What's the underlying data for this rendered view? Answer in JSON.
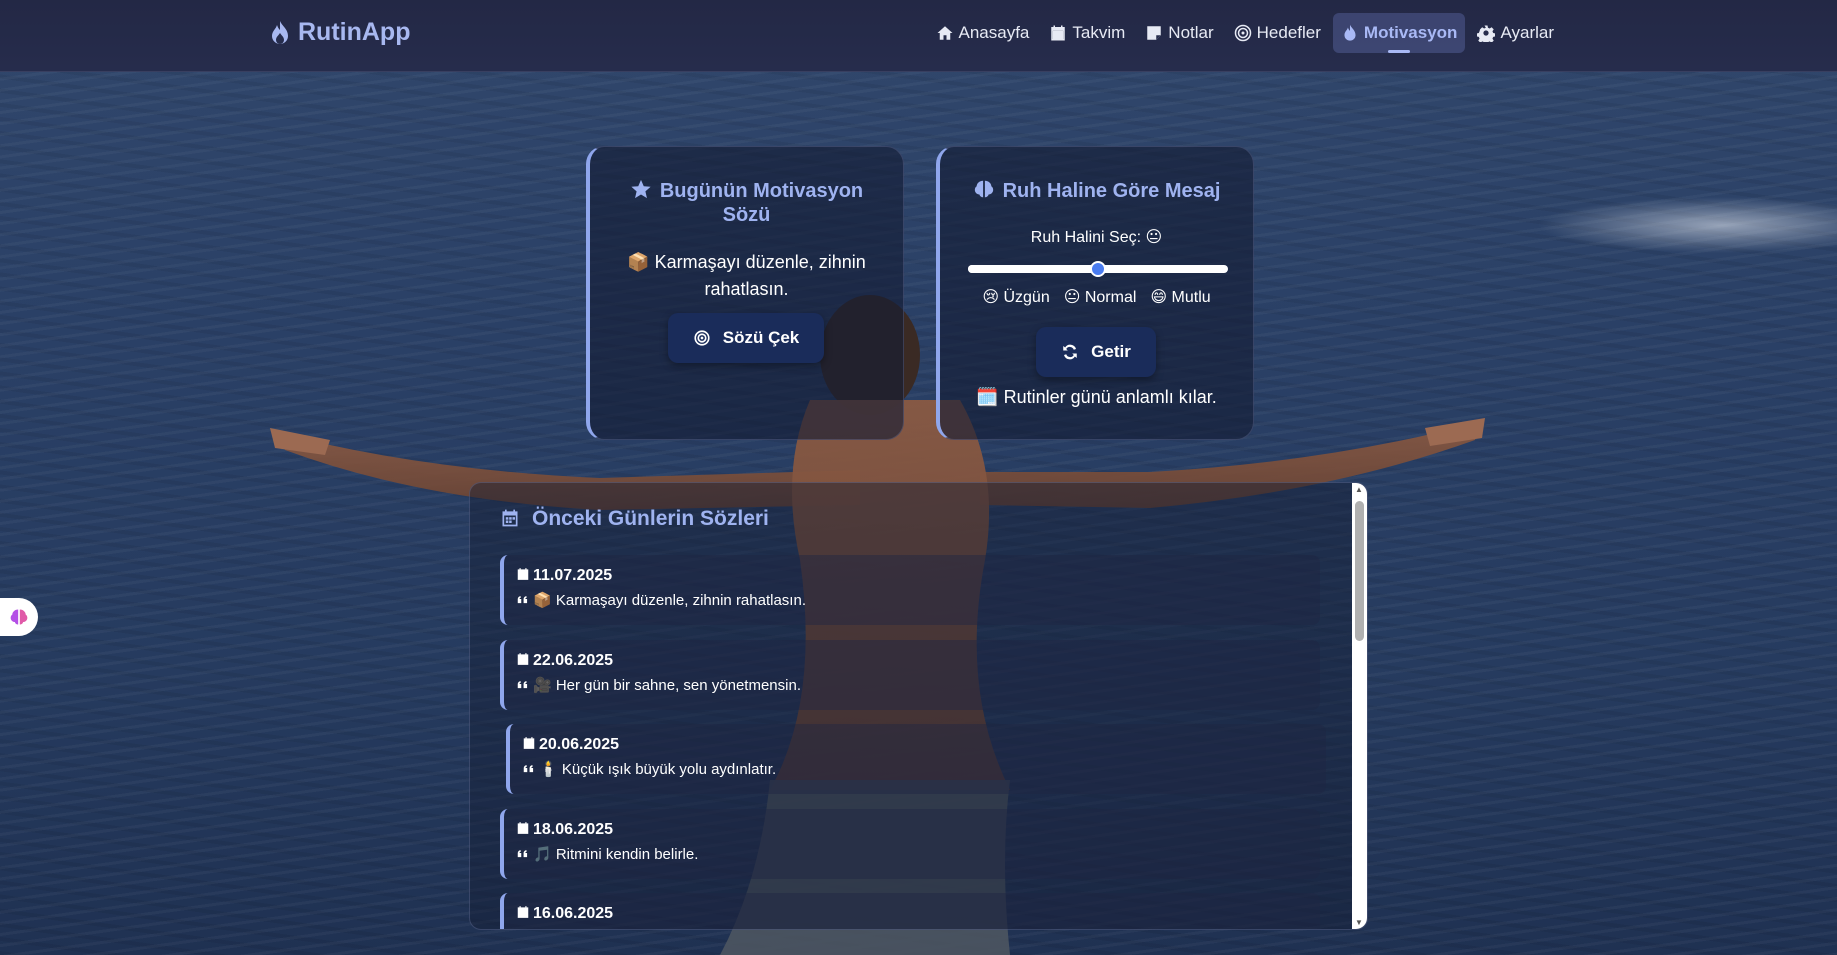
{
  "app": {
    "brand": "RutinApp"
  },
  "nav": {
    "items": [
      {
        "label": "Anasayfa",
        "icon": "home-icon"
      },
      {
        "label": "Takvim",
        "icon": "calendar-icon"
      },
      {
        "label": "Notlar",
        "icon": "note-icon"
      },
      {
        "label": "Hedefler",
        "icon": "target-icon"
      },
      {
        "label": "Motivasyon",
        "icon": "flame-icon",
        "active": true
      },
      {
        "label": "Ayarlar",
        "icon": "gear-icon"
      }
    ]
  },
  "daily_quote": {
    "title": "Bugünün Motivasyon Sözü",
    "quote": "📦 Karmaşayı düzenle, zihnin rahatlasın.",
    "button_label": "Sözü Çek"
  },
  "mood": {
    "title": "Ruh Haline Göre Mesaj",
    "prompt": "Ruh Halini Seç: 😐",
    "slider_value": 0.5,
    "labels": [
      "😢 Üzgün",
      "😐 Normal",
      "😄 Mutlu"
    ],
    "button_label": "Getir",
    "message": "🗓️ Rutinler günü anlamlı kılar."
  },
  "history": {
    "title": "Önceki Günlerin Sözleri",
    "entries": [
      {
        "date": "11.07.2025",
        "text": "📦 Karmaşayı düzenle, zihnin rahatlasın."
      },
      {
        "date": "22.06.2025",
        "text": "🎥 Her gün bir sahne, sen yönetmensin."
      },
      {
        "date": "20.06.2025",
        "text": "🕯️ Küçük ışık büyük yolu aydınlatır."
      },
      {
        "date": "18.06.2025",
        "text": "🎵 Ritmini kendin belirle."
      },
      {
        "date": "16.06.2025",
        "text": ""
      }
    ]
  },
  "colors": {
    "accent": "#9fb3f0",
    "navbar": "#252a48",
    "button": "#1a2c5a",
    "slider_thumb": "#4a7cf0"
  }
}
